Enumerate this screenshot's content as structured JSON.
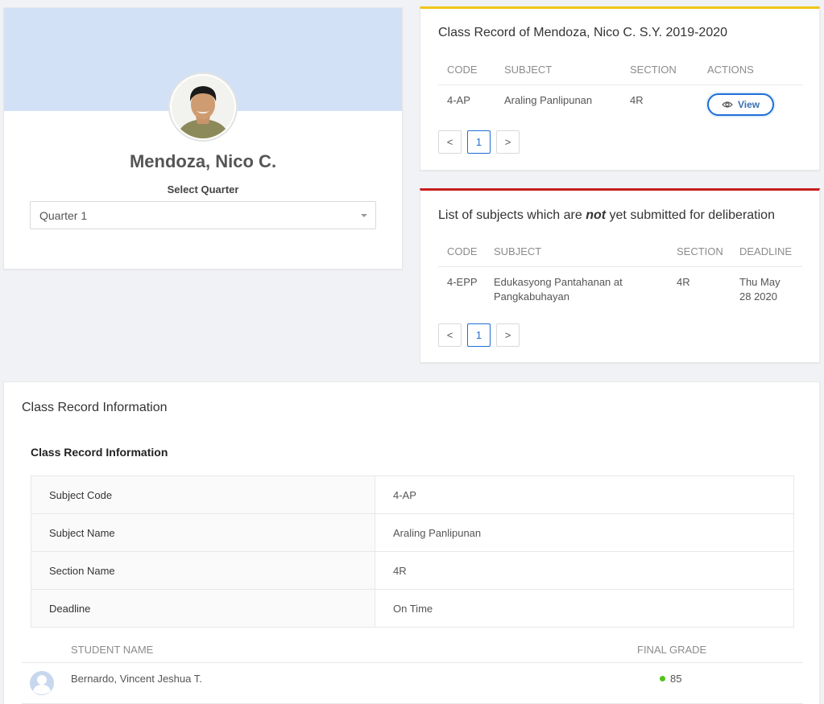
{
  "profile": {
    "name": "Mendoza, Nico C.",
    "select_label": "Select Quarter",
    "quarter_value": "Quarter 1",
    "banner_color": "#d2e1f5"
  },
  "class_record": {
    "title": "Class Record of Mendoza, Nico C. S.Y. 2019-2020",
    "accent_color": "#f0c419",
    "columns": [
      "CODE",
      "SUBJECT",
      "SECTION",
      "ACTIONS"
    ],
    "rows": [
      {
        "code": "4-AP",
        "subject": "Araling Panlipunan",
        "section": "4R",
        "action_label": "View",
        "action_icon": "eye-icon"
      }
    ],
    "pager": {
      "prev": "<",
      "page": "1",
      "next": ">"
    }
  },
  "pending": {
    "title_before": "List of subjects which are ",
    "title_emphasis": "not",
    "title_after": " yet submitted for deliberation",
    "accent_color": "#c81e1e",
    "columns": [
      "CODE",
      "SUBJECT",
      "SECTION",
      "DEADLINE"
    ],
    "rows": [
      {
        "code": "4-EPP",
        "subject": "Edukasyong Pantahanan at Pangkabuhayan",
        "section": "4R",
        "deadline": "Thu May 28 2020"
      }
    ],
    "pager": {
      "prev": "<",
      "page": "1",
      "next": ">"
    }
  },
  "info": {
    "card_title": "Class Record Information",
    "section_title": "Class Record Information",
    "fields": [
      {
        "label": "Subject Code",
        "value": "4-AP"
      },
      {
        "label": "Subject Name",
        "value": "Araling Panlipunan"
      },
      {
        "label": "Section Name",
        "value": "4R"
      },
      {
        "label": "Deadline",
        "value": "On Time"
      }
    ],
    "students_columns": [
      "STUDENT NAME",
      "FINAL GRADE"
    ],
    "students": [
      {
        "name": "Bernardo, Vincent Jeshua T.",
        "grade": "85",
        "status_color": "#52c41a",
        "avatar_icon": "user-avatar-icon"
      }
    ]
  },
  "colors": {
    "primary": "#1f6fd6",
    "background": "#f0f2f5"
  }
}
